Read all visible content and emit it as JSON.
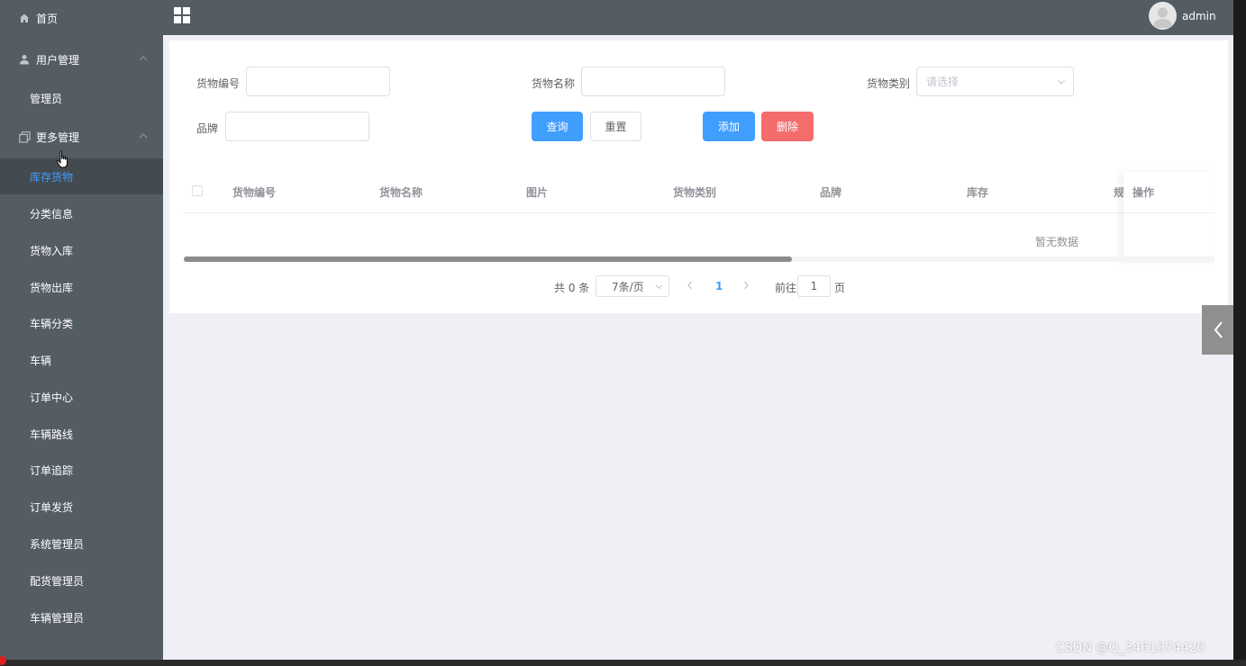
{
  "sidebar": {
    "home": "首页",
    "user_mgmt": "用户管理",
    "admin": "管理员",
    "more_mgmt": "更多管理",
    "items": [
      {
        "label": "库存货物",
        "active": true
      },
      {
        "label": "分类信息"
      },
      {
        "label": "货物入库"
      },
      {
        "label": "货物出库"
      },
      {
        "label": "车辆分类"
      },
      {
        "label": "车辆"
      },
      {
        "label": "订单中心"
      },
      {
        "label": "车辆路线"
      },
      {
        "label": "订单追踪"
      },
      {
        "label": "订单发货"
      },
      {
        "label": "系统管理员"
      },
      {
        "label": "配货管理员"
      },
      {
        "label": "车辆管理员"
      }
    ]
  },
  "header": {
    "username": "admin"
  },
  "search": {
    "goods_no_label": "货物编号",
    "goods_no_value": "",
    "goods_name_label": "货物名称",
    "goods_name_value": "",
    "goods_type_label": "货物类别",
    "goods_type_placeholder": "请选择",
    "brand_label": "品牌",
    "brand_value": "",
    "query_btn": "查询",
    "reset_btn": "重置",
    "add_btn": "添加",
    "delete_btn": "删除"
  },
  "table": {
    "columns": [
      "货物编号",
      "货物名称",
      "图片",
      "货物类别",
      "品牌",
      "库存",
      "规格",
      "操作"
    ],
    "empty_text": "暂无数据"
  },
  "pagination": {
    "total_text": "共 0 条",
    "page_size": "7条/页",
    "current_page": "1",
    "goto_label": "前往",
    "goto_value": "1",
    "page_unit": "页"
  },
  "watermark": "CSDN @Q_3461074420",
  "colors": {
    "sidebar_bg": "#545c64",
    "primary": "#409eff",
    "danger": "#f56c6c",
    "main_bg": "#f0eff5"
  }
}
